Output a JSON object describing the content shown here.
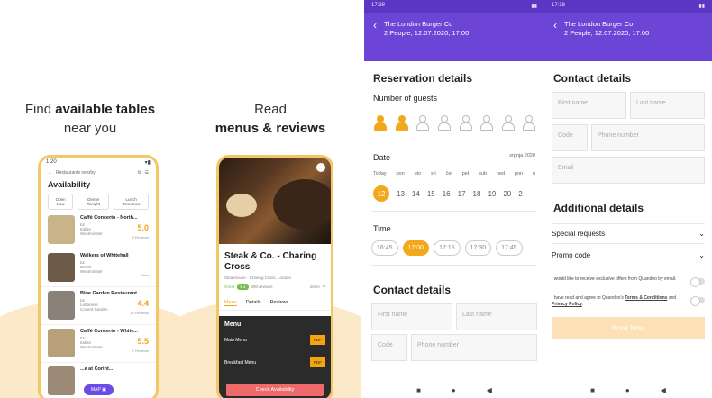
{
  "panel1": {
    "headline_pre": "Find ",
    "headline_bold": "available tables",
    "headline_line2": "near you",
    "status_time": "1:20",
    "back_label": "Restaurants nearby",
    "title": "Availability",
    "chips": [
      "Open Now",
      "Dinner Tonight",
      "Lunch Tomorrow"
    ],
    "restaurants": [
      {
        "name": "Caffè Concerto - North...",
        "price": "££",
        "cuisine": "Italian",
        "area": "Westminster",
        "score": "5.0",
        "reviews": "8 Reviews",
        "thumb": "#c9b48a"
      },
      {
        "name": "Walkers of Whitehall",
        "price": "££",
        "cuisine": "British",
        "area": "Westminster",
        "score": "",
        "reviews": "New",
        "thumb": "#6e5a48"
      },
      {
        "name": "Blue Garden Restaurant",
        "price": "££",
        "cuisine": "Lebanese",
        "area": "Covent Garden",
        "score": "4.4",
        "reviews": "13 Reviews",
        "thumb": "#8a8178"
      },
      {
        "name": "Caffè Concerto - White...",
        "price": "££",
        "cuisine": "Italian",
        "area": "Westminster",
        "score": "5.5",
        "reviews": "2 Reviews",
        "thumb": "#b8a07a"
      },
      {
        "name": "...e at Corint...",
        "price": "",
        "cuisine": "",
        "area": "",
        "score": "",
        "reviews": "",
        "thumb": "#9c8a76"
      }
    ],
    "map_label": "MAP"
  },
  "panel2": {
    "headline_line1": "Read",
    "headline_bold": "menus & reviews",
    "name": "Steak & Co. - Charing Cross",
    "subtitle": "Steakhouse · Charing Cross, London",
    "rating_label": "Great",
    "rating_value": "5.4",
    "reviews": "290 reviews",
    "distance": "28km",
    "tabs": [
      "Menu",
      "Details",
      "Reviews"
    ],
    "menu_title": "Menu",
    "menu_items": [
      {
        "name": "Main Menu",
        "tag": "PDF"
      },
      {
        "name": "Breakfast Menu",
        "tag": "PDF"
      }
    ],
    "cta": "Check Availability"
  },
  "panel3": {
    "status_time": "17:38",
    "venue": "The London Burger Co",
    "booking": "2 People, 12.07.2020, 17:00",
    "section_title": "Reservation details",
    "guests_label": "Number of guests",
    "guests_selected": 2,
    "guests_total": 8,
    "date_label": "Date",
    "month": "srpnja 2020",
    "weekdays": [
      "Today",
      "pon",
      "uto",
      "sri",
      "čet",
      "pet",
      "sub",
      "ned",
      "pon",
      "u"
    ],
    "days": [
      "12",
      "13",
      "14",
      "15",
      "16",
      "17",
      "18",
      "19",
      "20",
      "2"
    ],
    "selected_day": "12",
    "time_label": "Time",
    "times": [
      "16:45",
      "17:00",
      "17:15",
      "17:30",
      "17:45"
    ],
    "selected_time": "17:00",
    "contact_title": "Contact details",
    "first_name": "First name",
    "last_name": "Last name",
    "code": "Code",
    "phone": "Phone number"
  },
  "panel4": {
    "status_time": "17:38",
    "venue": "The London Burger Co",
    "booking": "2 People, 12.07.2020, 17:00",
    "contact_title": "Contact details",
    "first_name": "First name",
    "last_name": "Last name",
    "code": "Code",
    "phone": "Phone number",
    "email": "Email",
    "additional_title": "Additional details",
    "special_requests": "Special requests",
    "promo_code": "Promo code",
    "offers_text": "I would like to receive exclusive offers from Quandoo by email.",
    "terms_pre": "I have read and agree to Quandoo's ",
    "terms_link": "Terms & Conditions",
    "terms_mid": " and ",
    "privacy_link": "Privacy Policy",
    "terms_end": ".",
    "cta": "Book Now"
  },
  "icons": {
    "back": "‹",
    "expand": "⌄",
    "nav_back": "◀",
    "nav_home": "●",
    "nav_recent": "■"
  },
  "colors": {
    "primary": "#6d45d6",
    "accent": "#f2a81c",
    "cream": "#fbe9c8"
  }
}
